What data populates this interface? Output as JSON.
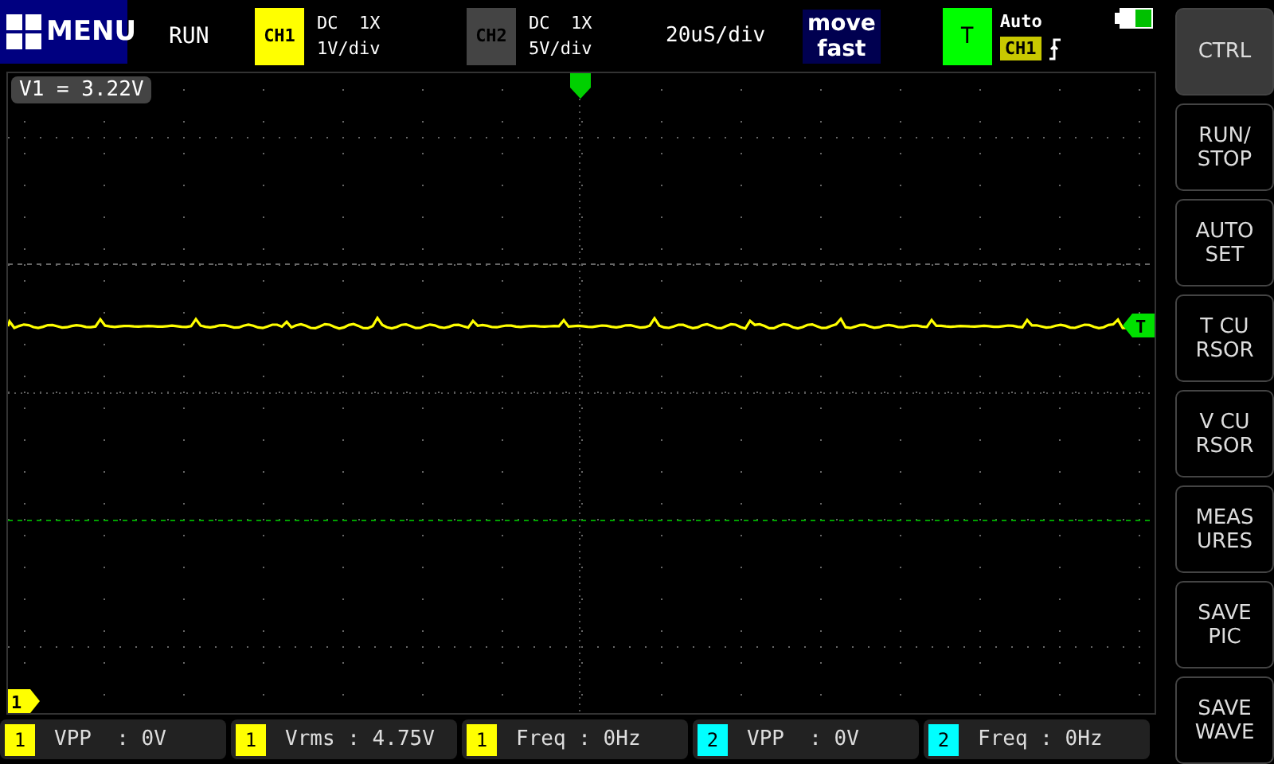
{
  "top_bar": {
    "menu_button": "MENU",
    "run_state": "RUN",
    "channels": [
      {
        "label": "CH1",
        "enabled": true,
        "color": "#ffff00",
        "coupling": "DC  1X",
        "scale": "1V/div"
      },
      {
        "label": "CH2",
        "enabled": false,
        "coupling": "DC  1X",
        "scale": "5V/div"
      }
    ],
    "timebase": "20uS/div",
    "move_mode": "move\nfast",
    "trigger": {
      "label": "T",
      "mode": "Auto",
      "source": "CH1"
    }
  },
  "scope": {
    "cursor_readout": "V1 = 3.22V",
    "channel_marker": "1",
    "trigger_marker": "T"
  },
  "measurements": [
    {
      "channel": "1",
      "color": "#ffff00",
      "text": "VPP  : 0V"
    },
    {
      "channel": "1",
      "color": "#ffff00",
      "text": "Vrms : 4.75V"
    },
    {
      "channel": "1",
      "color": "#ffff00",
      "text": "Freq : 0Hz"
    },
    {
      "channel": "2",
      "color": "#00ffff",
      "text": "VPP  : 0V"
    },
    {
      "channel": "2",
      "color": "#00ffff",
      "text": "Freq : 0Hz"
    }
  ],
  "sidebar": [
    {
      "label": "CTRL",
      "selected": true
    },
    {
      "label": "RUN/\nSTOP",
      "selected": false
    },
    {
      "label": "AUTO\nSET",
      "selected": false
    },
    {
      "label": "T CU\nRSOR",
      "selected": false
    },
    {
      "label": "V CU\nRSOR",
      "selected": false
    },
    {
      "label": "MEAS\nURES",
      "selected": false
    },
    {
      "label": "SAVE\nPIC",
      "selected": false
    },
    {
      "label": "SAVE\nWAVE",
      "selected": false
    }
  ]
}
